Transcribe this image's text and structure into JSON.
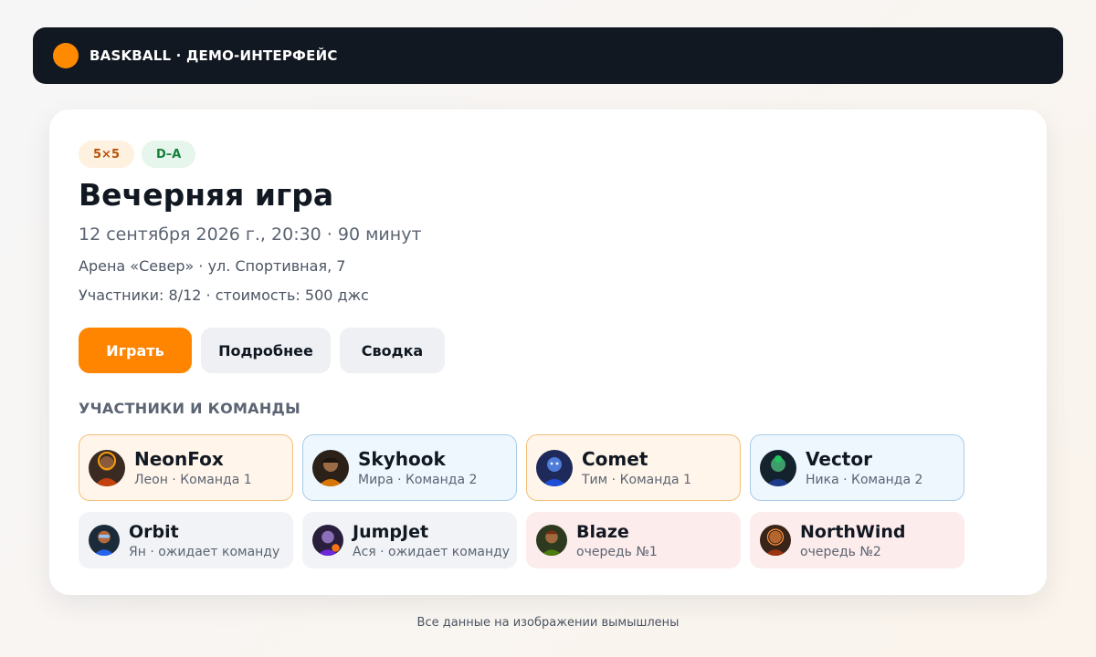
{
  "app": {
    "title": "BASKBALL · ДЕМО-ИНТЕРФЕЙС",
    "accent_color": "#ff8a00"
  },
  "game": {
    "badges": {
      "format": "5×5",
      "level": "D–A"
    },
    "title": "Вечерняя игра",
    "datetime": "12 сентября 2026 г., 20:30 · 90 минут",
    "venue": "Арена «Север» · ул. Спортивная, 7",
    "participants": "Участники: 8/12 · стоимость: 500 джс"
  },
  "actions": {
    "play": "Играть",
    "details": "Подробнее",
    "summary": "Сводка"
  },
  "roster": {
    "title": "УЧАСТНИКИ И КОМАНДЫ",
    "players": [
      {
        "nick": "NeonFox",
        "sub": "Леон · Команда 1",
        "status": "team1"
      },
      {
        "nick": "Skyhook",
        "sub": "Мира · Команда 2",
        "status": "team2"
      },
      {
        "nick": "Comet",
        "sub": "Тим · Команда 1",
        "status": "team1"
      },
      {
        "nick": "Vector",
        "sub": "Ника · Команда 2",
        "status": "team2"
      },
      {
        "nick": "Orbit",
        "sub": "Ян · ожидает команду",
        "status": "waiting"
      },
      {
        "nick": "JumpJet",
        "sub": "Ася · ожидает команду",
        "status": "waiting"
      },
      {
        "nick": "Blaze",
        "sub": "очередь №1",
        "status": "queue"
      },
      {
        "nick": "NorthWind",
        "sub": "очередь №2",
        "status": "queue"
      }
    ]
  },
  "footer": {
    "disclaimer": "Все данные на изображении вымышлены"
  }
}
